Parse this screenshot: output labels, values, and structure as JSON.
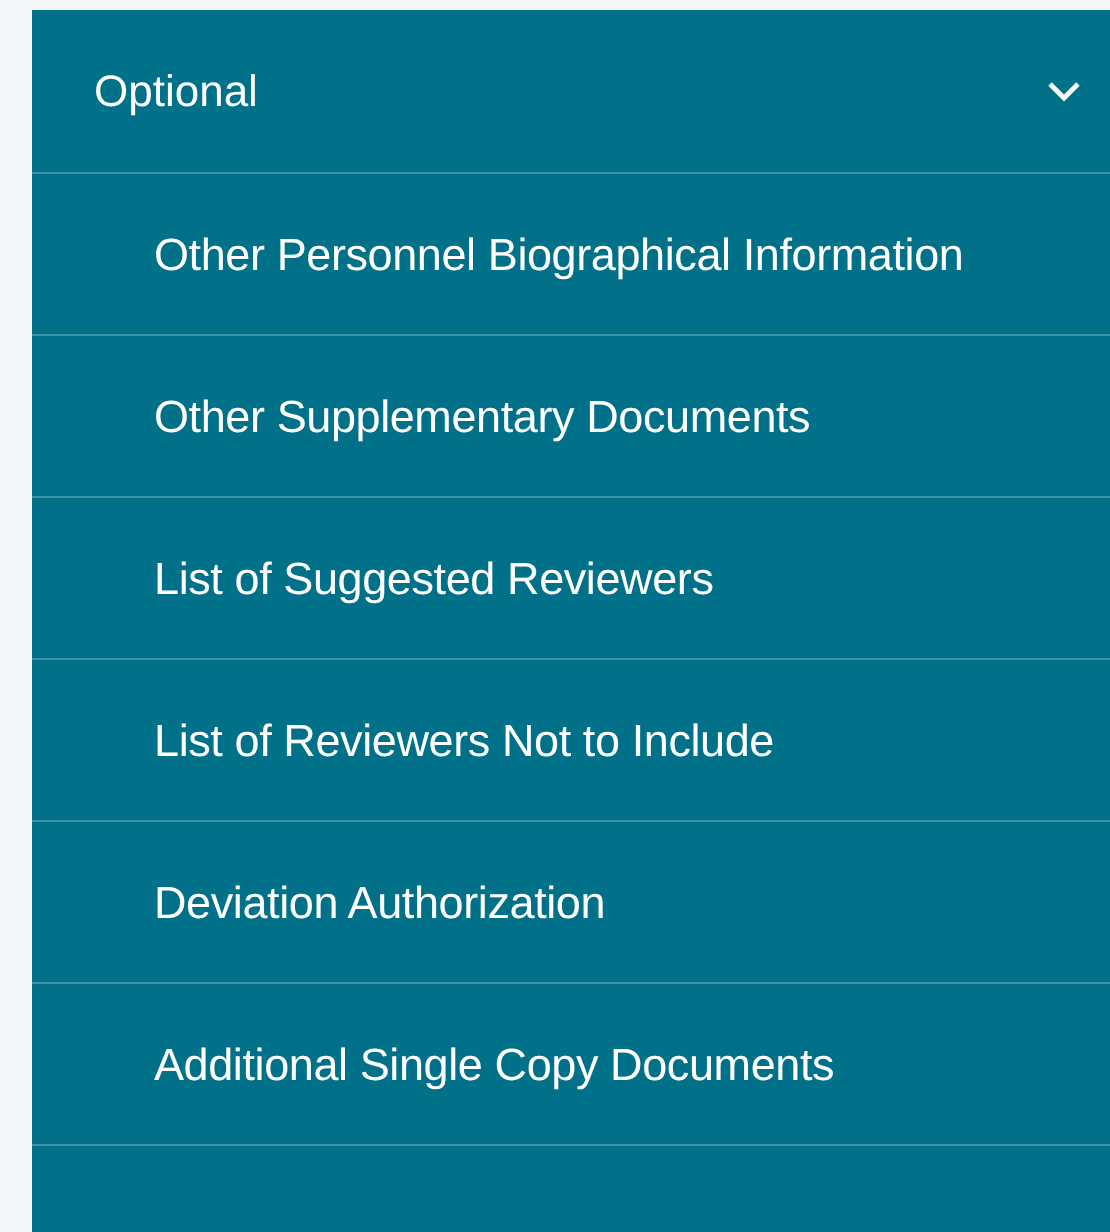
{
  "section": {
    "title": "Optional",
    "expanded": true,
    "items": [
      {
        "label": "Other Personnel Biographical Information"
      },
      {
        "label": "Other Supplementary Documents"
      },
      {
        "label": "List of Suggested Reviewers"
      },
      {
        "label": "List of Reviewers Not to Include"
      },
      {
        "label": "Deviation Authorization"
      },
      {
        "label": "Additional Single Copy Documents"
      }
    ]
  }
}
